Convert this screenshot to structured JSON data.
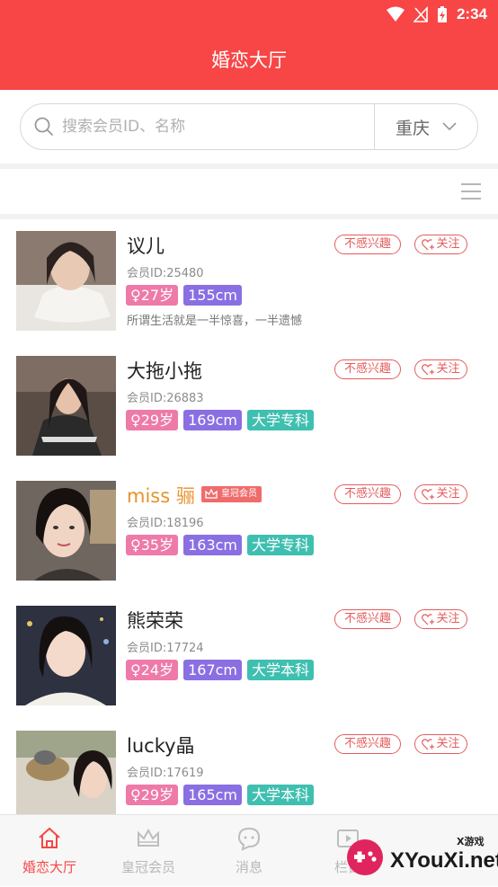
{
  "status_bar": {
    "time": "2:34"
  },
  "header": {
    "title": "婚恋大厅"
  },
  "search": {
    "placeholder": "搜索会员ID、名称",
    "value": "",
    "city": "重庆"
  },
  "actions": {
    "not_interested": "不感兴趣",
    "follow": "关注"
  },
  "members": [
    {
      "name": "议儿",
      "id": "会员ID:25480",
      "tags": [
        "♀27岁",
        "155cm"
      ],
      "motto": "所谓生活就是一半惊喜，一半遗憾"
    },
    {
      "name": "大拖小拖",
      "id": "会员ID:26883",
      "tags": [
        "♀29岁",
        "169cm",
        "大学专科"
      ]
    },
    {
      "name": "miss 骊",
      "vip_badge": "皇冠会员",
      "id": "会员ID:18196",
      "tags": [
        "♀35岁",
        "163cm",
        "大学专科"
      ]
    },
    {
      "name": "熊荣荣",
      "id": "会员ID:17724",
      "tags": [
        "♀24岁",
        "167cm",
        "大学本科"
      ]
    },
    {
      "name": "lucky晶",
      "id": "会员ID:17619",
      "tags": [
        "♀29岁",
        "165cm",
        "大学本科"
      ]
    }
  ],
  "tabbar": {
    "items": [
      {
        "label": "婚恋大厅",
        "icon": "home-icon",
        "active": true
      },
      {
        "label": "皇冠会员",
        "icon": "crown-icon",
        "active": false
      },
      {
        "label": "消息",
        "icon": "chat-icon",
        "active": false
      },
      {
        "label": "栏目",
        "icon": "video-icon",
        "active": false
      }
    ]
  },
  "watermark": {
    "small": "X游戏",
    "text": "XYouXi.net"
  },
  "colors": {
    "brand": "#f84646",
    "tag_age": "#ee7aa9",
    "tag_height": "#8a6fe3",
    "tag_education": "#3fbfb0",
    "vip_name": "#e8922a"
  }
}
